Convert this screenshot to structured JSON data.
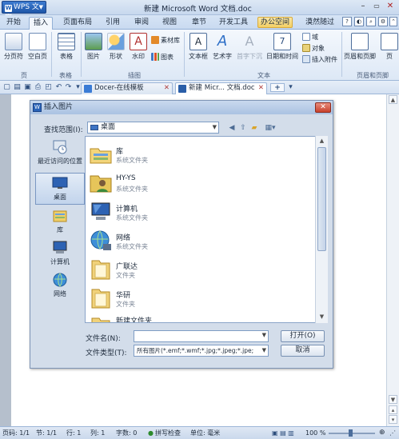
{
  "titlebar": {
    "app_menu": "WPS 文字",
    "document_title": "新建 Microsoft Word 文档.doc"
  },
  "ribbon_tabs": [
    "开始",
    "插入",
    "页面布局",
    "引用",
    "审阅",
    "视图",
    "章节",
    "开发工具",
    "办公空间",
    "漠然随过"
  ],
  "active_tab": "插入",
  "ribbon": {
    "pages": {
      "page_break": "分页符",
      "blank_page": "空白页",
      "group": "页"
    },
    "tables": {
      "table": "表格",
      "group": "表格"
    },
    "illustrations": {
      "picture": "图片",
      "shapes": "形状",
      "watermark": "水印",
      "material_lib": "素材库",
      "chart": "图表",
      "group": "插图"
    },
    "text": {
      "textbox": "文本框",
      "art_text": "艺术字",
      "drop_cap": "首字下沉",
      "datetime": "日期和时间",
      "field": "域",
      "object": "对象",
      "attachment": "插入附件",
      "group": "文本"
    },
    "header_footer": {
      "header_footer": "页眉和页脚",
      "page_number": "页",
      "group": "页眉和页脚"
    }
  },
  "doc_tabs": [
    "Docer-在线模板",
    "新建 Micr... 文档.doc"
  ],
  "doc_tab_add": "+",
  "dialog": {
    "title": "插入图片",
    "look_in_label": "查找范围(I):",
    "look_in_value": "桌面",
    "places": [
      "最近访问的位置",
      "桌面",
      "库",
      "计算机",
      "网络"
    ],
    "selected_place": "桌面",
    "files": [
      {
        "name": "库",
        "type": "系统文件夹",
        "icon": "library-folder-icon"
      },
      {
        "name": "HY-YS",
        "type": "系统文件夹",
        "icon": "user-folder-icon"
      },
      {
        "name": "计算机",
        "type": "系统文件夹",
        "icon": "computer-icon"
      },
      {
        "name": "网络",
        "type": "系统文件夹",
        "icon": "network-icon"
      },
      {
        "name": "广联达",
        "type": "文件夹",
        "icon": "folder-icon"
      },
      {
        "name": "华研",
        "type": "文件夹",
        "icon": "folder-icon"
      },
      {
        "name": "新建文件夹",
        "type": "",
        "icon": "folder-icon"
      }
    ],
    "filename_label": "文件名(N):",
    "filename_value": "",
    "filetype_label": "文件类型(T):",
    "filetype_value": "所有图片(*.emf;*.wmf;*.jpg;*.jpeg;*.jpe;",
    "open_button": "打开(O)",
    "cancel_button": "取消"
  },
  "statusbar": {
    "page": "页码: 1/1",
    "section": "节: 1/1",
    "row": "行: 1",
    "col": "列: 1",
    "words": "字数: 0",
    "spellcheck": "拼写检查",
    "unit": "单位: 毫米",
    "zoom": "100 %"
  }
}
